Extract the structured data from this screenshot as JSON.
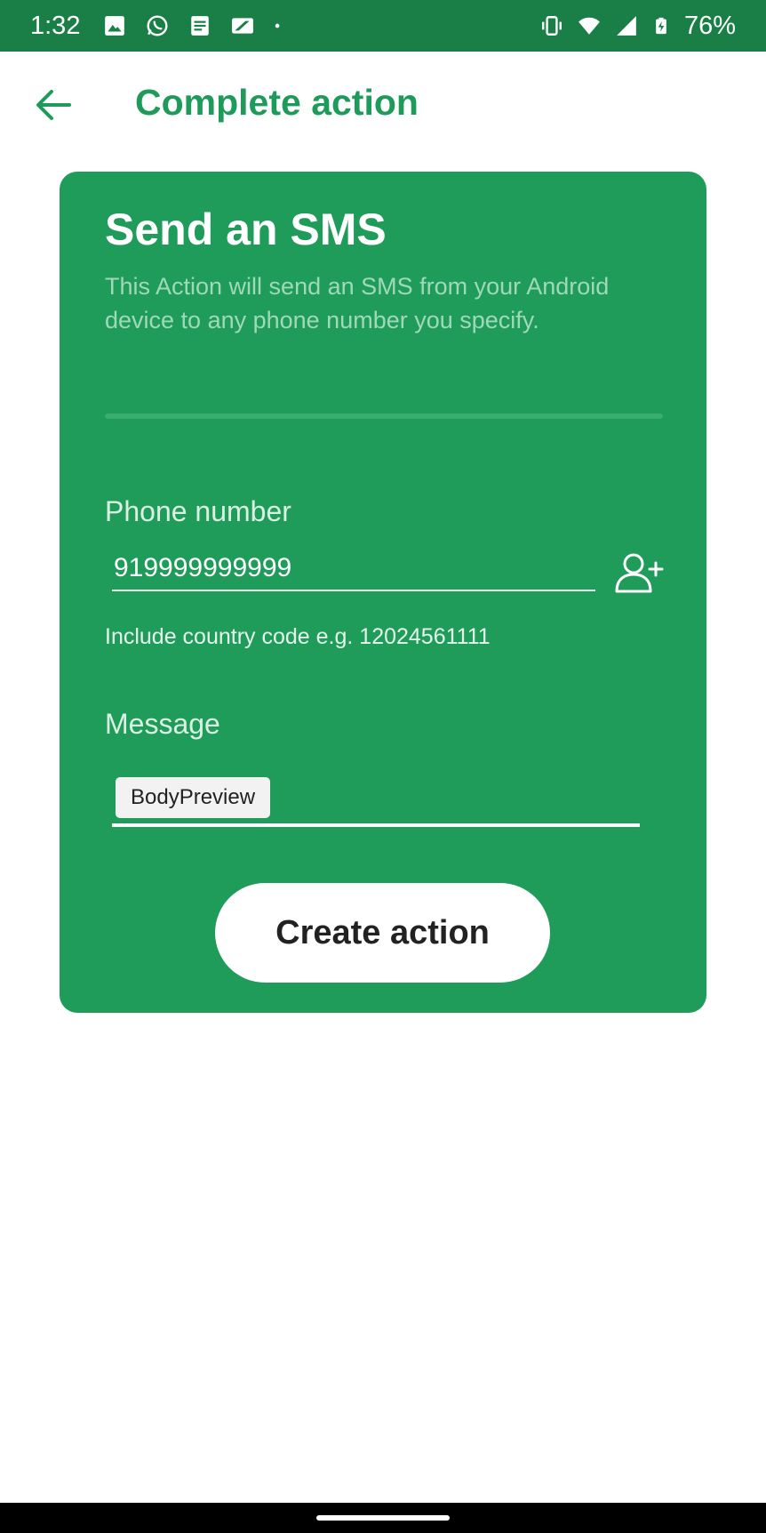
{
  "status_bar": {
    "time": "1:32",
    "battery": "76%",
    "left_icons": [
      "gallery-icon",
      "whatsapp-icon",
      "docs-icon",
      "slides-icon",
      "dot-icon"
    ],
    "right_icons": [
      "vibrate-icon",
      "wifi-icon",
      "signal-icon",
      "battery-charging-icon"
    ],
    "background": "#1a7f47"
  },
  "app_bar": {
    "title": "Complete action",
    "back_icon": "arrow-left-icon"
  },
  "card": {
    "title": "Send an SMS",
    "description": "This Action will send an SMS from your Android device to any phone number you specify.",
    "phone": {
      "label": "Phone number",
      "value": "919999999999",
      "help": "Include country code e.g. 12024561111",
      "contact_icon": "add-contact-icon"
    },
    "message": {
      "label": "Message",
      "ingredient": "BodyPreview"
    },
    "create_button": "Create action",
    "background": "#1f9b5a"
  },
  "colors": {
    "accent": "#1e9b5b",
    "card": "#1f9b5a",
    "status_bar": "#1a7f47"
  }
}
